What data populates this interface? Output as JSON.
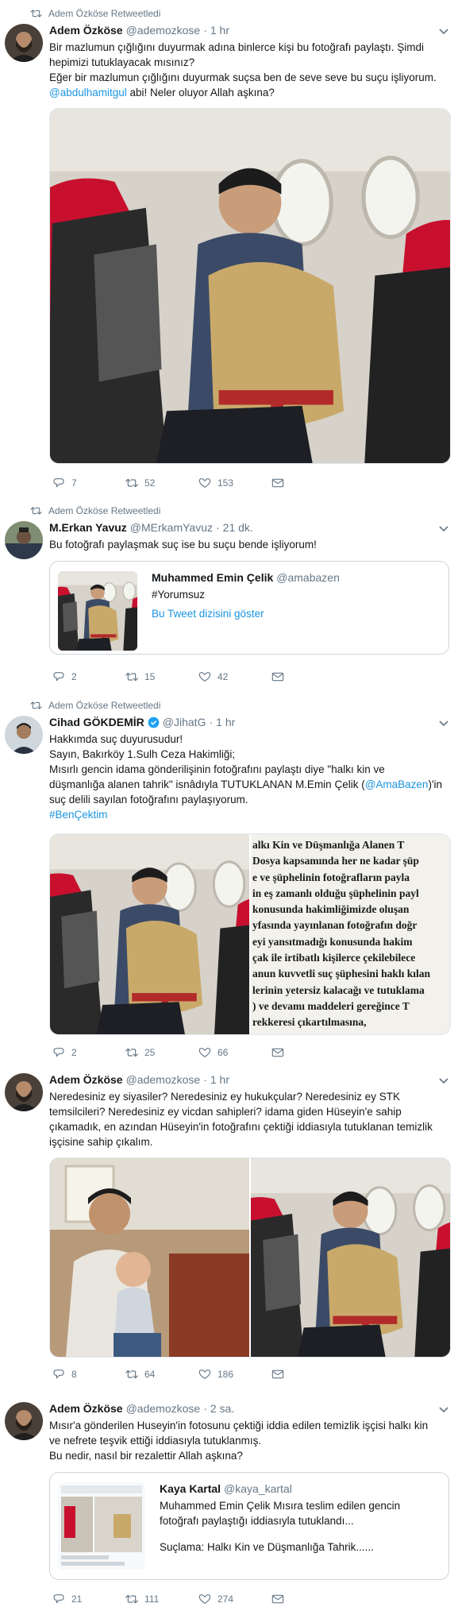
{
  "icons": {
    "retweeted": "retweet-icon",
    "reply": "reply-icon",
    "retweet": "retweet-icon",
    "like": "heart-icon",
    "dm": "envelope-icon",
    "caret": "chevron-down-icon",
    "verified": "verified-badge-icon"
  },
  "colors": {
    "link": "#1b95e0",
    "secondary": "#657786",
    "separator": "#e6ecf0",
    "verified": "#1da1f2"
  },
  "tweets": [
    {
      "retweeted_by": "Adem Özköse Retweetledi",
      "name": "Adem Özköse",
      "handle": "@ademozkose",
      "dot": "·",
      "time": "1 hr",
      "text": {
        "l1": "Bir mazlumun çığlığını duyurmak adına binlerce kişi bu fotoğrafı paylaştı. Şimdi",
        "l2": "hepimizi tutuklayacak mısınız?",
        "l3": "Eğer bir mazlumun çığlığını duyurmak suçsa ben de seve seve bu suçu işliyorum.",
        "l4_link": "@abdulhamitgul",
        "l4_rest": " abi! Neler oluyor Allah aşkına?"
      },
      "counts": {
        "reply": "7",
        "retweet": "52",
        "like": "153"
      }
    },
    {
      "retweeted_by": "Adem Özköse Retweetledi",
      "name": "M.Erkan Yavuz",
      "handle": "@MErkamYavuz",
      "dot": "·",
      "time": "21 dk.",
      "text": {
        "l1": "Bu fotoğrafı paylaşmak suç ise bu suçu bende işliyorum!"
      },
      "quote": {
        "name": "Muhammed Emin Çelik",
        "handle": "@amabazen",
        "text": "#Yorumsuz",
        "show_thread": "Bu Tweet dizisini göster"
      },
      "counts": {
        "reply": "2",
        "retweet": "15",
        "like": "42"
      }
    },
    {
      "retweeted_by": "Adem Özköse Retweetledi",
      "name": "Cihad GÖKDEMİR",
      "handle": "@JihatG",
      "dot": "·",
      "time": "1 hr",
      "text": {
        "l1": "Hakkımda suç duyurusudur!",
        "l2": "Sayın, Bakırköy 1.Sulh Ceza Hakimliği;",
        "l3": "Mısırlı gencin idama gönderilişinin fotoğrafını paylaştı diye \"halkı kin ve",
        "l4a": "düşmanlığa alanen tahrik\" isnâdıyla TUTUKLANAN M.Emin Çelik (",
        "l4_link": "@AmaBazen",
        "l4b": ")'in",
        "l5": "suç delili sayılan fotoğrafını paylaşıyorum.",
        "l6_link": "#BenÇektim"
      },
      "document_lines": [
        "alkı Kin ve Düşmanlığa Alanen T",
        "Dosya kapsamında her ne kadar şüp",
        "e ve şüphelinin fotoğrafların payla",
        "in eş zamanlı olduğu şüphelinin payl",
        "konusunda hakimliğimizde oluşan",
        "yfasında yayınlanan fotoğrafın doğr",
        "eyi yansıtmadığı konusunda hakim",
        "çak ile irtibatlı kişilerce çekilebilece",
        "anun kuvvetli suç şüphesini haklı kılan",
        "lerinin yetersiz kalacağı ve tutuklama",
        ") ve devamı maddeleri gereğince T",
        "rekkeresi çıkartılmasına,"
      ],
      "counts": {
        "reply": "2",
        "retweet": "25",
        "like": "66"
      }
    },
    {
      "name": "Adem Özköse",
      "handle": "@ademozkose",
      "dot": "·",
      "time": "1 hr",
      "text": {
        "l1": "Neredesiniz ey siyasiler? Neredesiniz ey hukukçular? Neredesiniz ey STK",
        "l2": "temsilcileri? Neredesiniz ey vicdan sahipleri? idama giden Hüseyin'e sahip",
        "l3": "çıkamadık, en azından Hüseyin'in fotoğrafını çektiği iddiasıyla tutuklanan temizlik",
        "l4": "işçisine sahip çıkalım."
      },
      "counts": {
        "reply": "8",
        "retweet": "64",
        "like": "186"
      }
    },
    {
      "name": "Adem Özköse",
      "handle": "@ademozkose",
      "dot": "·",
      "time": "2 sa.",
      "text": {
        "l1": "Mısır'a gönderilen Huseyin'in fotosunu çektiği iddia edilen temizlik işçisi halkı kin",
        "l2": "ve nefrete teşvik ettiği iddiasıyla tutuklanmış.",
        "l3": "Bu nedir, nasıl bir rezalettir Allah aşkına?"
      },
      "quote": {
        "name": "Kaya Kartal",
        "handle": "@kaya_kartal",
        "l1": "Muhammed Emin Çelik Mısıra teslim edilen gencin",
        "l2": "fotoğrafı paylaştığı iddiasıyla tutuklandı...",
        "l3": "Suçlama: Halkı Kin ve Düşmanlığa Tahrik......"
      },
      "counts": {
        "reply": "21",
        "retweet": "111",
        "like": "274"
      }
    }
  ]
}
